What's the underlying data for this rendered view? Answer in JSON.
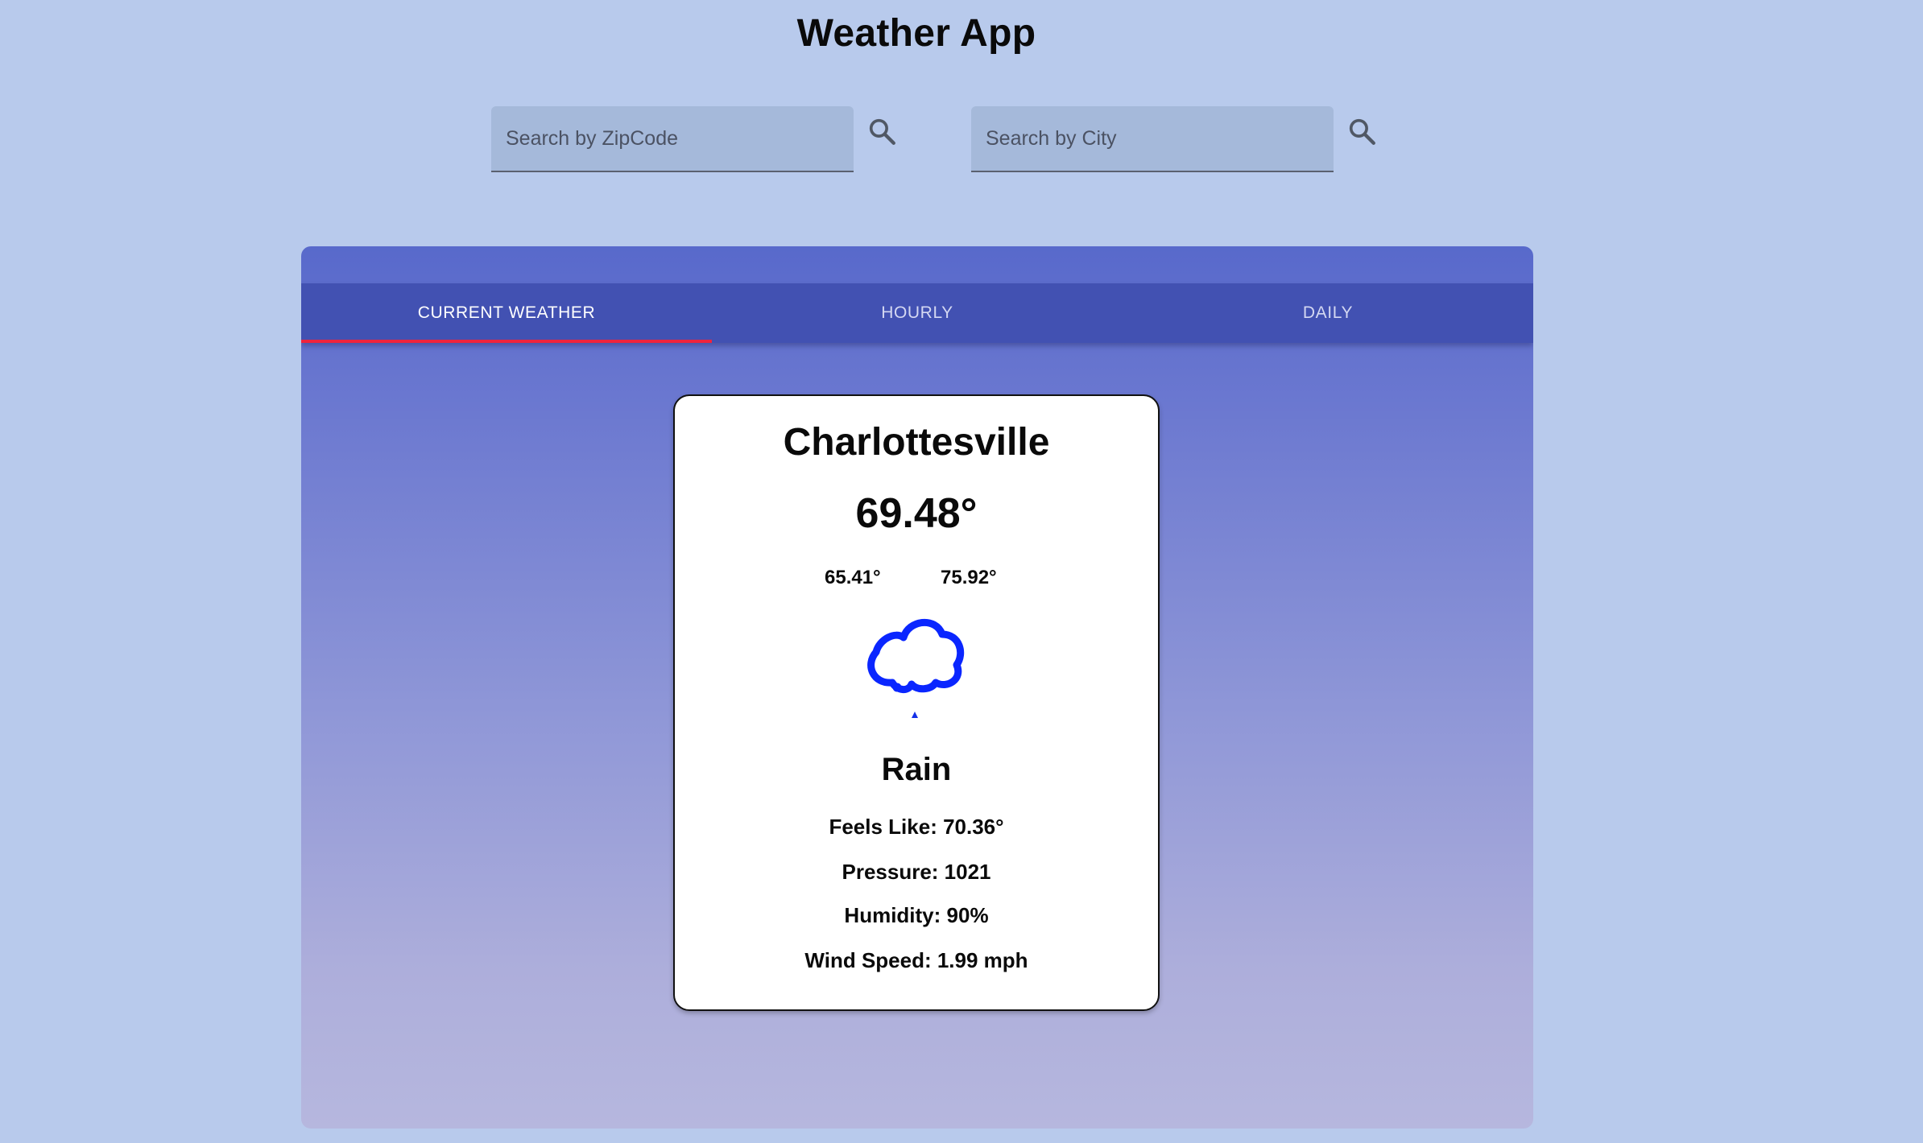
{
  "header": {
    "title": "Weather App"
  },
  "search": {
    "zip_placeholder": "Search by ZipCode",
    "city_placeholder": "Search by City"
  },
  "tabs": [
    {
      "label": "CURRENT WEATHER",
      "active": true
    },
    {
      "label": "HOURLY",
      "active": false
    },
    {
      "label": "DAILY",
      "active": false
    }
  ],
  "current": {
    "city": "Charlottesville",
    "temperature": "69.48°",
    "min_temp": "65.41°",
    "max_temp": "75.92°",
    "icon": "rain-cloud-icon",
    "condition": "Rain",
    "feels_like": "Feels Like: 70.36°",
    "pressure": "Pressure: 1021",
    "humidity": "Humidity: 90%",
    "wind_speed": "Wind Speed: 1.99 mph"
  },
  "colors": {
    "page_background": "#b8caec",
    "tab_bar": "#4251b2",
    "active_tab_indicator": "#f0233d",
    "icon_blue": "#0a26ff"
  }
}
